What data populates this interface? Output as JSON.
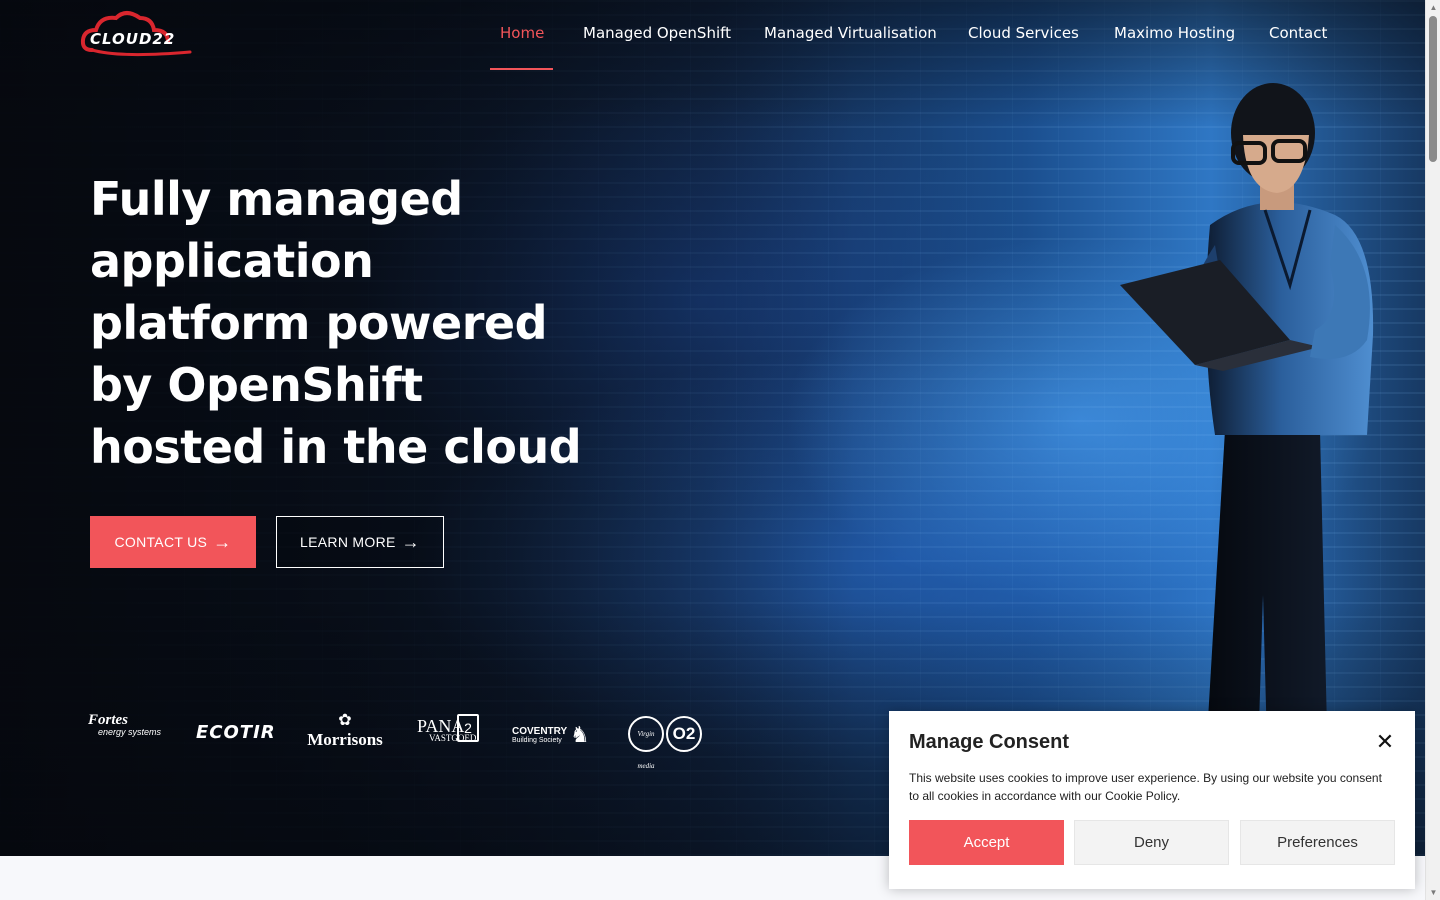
{
  "brand": {
    "logo_text": "CLOUD22",
    "accent_color": "#f2555a"
  },
  "nav": {
    "items": [
      {
        "label": "Home",
        "active": true
      },
      {
        "label": "Managed OpenShift"
      },
      {
        "label": "Managed Virtualisation"
      },
      {
        "label": "Cloud Services"
      },
      {
        "label": "Maximo Hosting"
      },
      {
        "label": "Contact"
      }
    ]
  },
  "hero": {
    "headline_lines": [
      "Fully managed",
      "application",
      "platform powered",
      "by OpenShift",
      "hosted in the cloud"
    ],
    "contact_label": "CONTACT US",
    "learn_label": "LEARN MORE",
    "arrow_icon": "arrow-right-icon"
  },
  "clients": {
    "fortes_name": "Fortes",
    "fortes_sub": "energy systems",
    "ecotir": "ECOTIR",
    "morrisons_name": "Morrisons",
    "pana_name": "PANA",
    "pana_sub": "VASTGOED",
    "pana_mark": "2",
    "coventry_name": "COVENTRY",
    "coventry_sub": "Building Society",
    "virgin": "Virgin media",
    "o2": "O2"
  },
  "consent": {
    "title": "Manage Consent",
    "text": "This website uses cookies to improve user experience. By using our website you consent to all cookies in accordance with our Cookie Policy.",
    "accept_label": "Accept",
    "deny_label": "Deny",
    "preferences_label": "Preferences"
  }
}
